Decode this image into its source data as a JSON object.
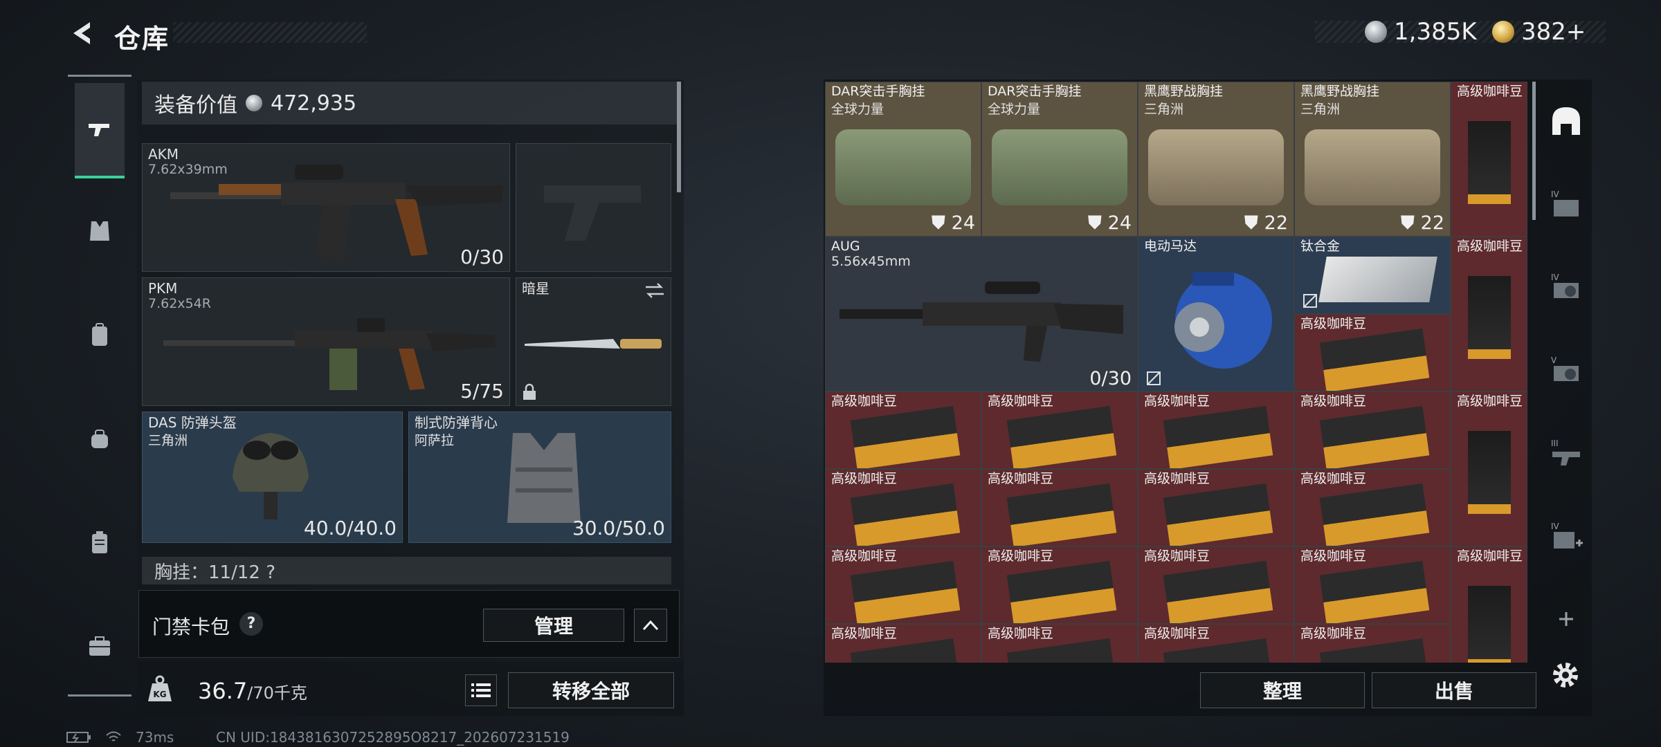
{
  "header": {
    "title": "仓库",
    "currency_silver": "1,385K",
    "currency_gold": "382+"
  },
  "rail": {
    "items": [
      "weapon-icon",
      "armor-vest-icon",
      "backpack-icon",
      "bag-icon",
      "clipboard-icon",
      "briefcase-icon"
    ]
  },
  "loadout": {
    "value_label": "装备价值",
    "value": "472,935",
    "primary": {
      "name": "AKM",
      "caliber": "7.62x39mm",
      "ammo": "0/30"
    },
    "secondary": {
      "name": "PKM",
      "caliber": "7.62x54R",
      "ammo": "5/75"
    },
    "melee": {
      "name": "暗星"
    },
    "helmet": {
      "name": "DAS 防弹头盔",
      "origin": "三角洲",
      "durability": "40.0/40.0"
    },
    "armor": {
      "name": "制式防弹背心",
      "origin": "阿萨拉",
      "durability": "30.0/50.0"
    },
    "chest_rig": "胸挂：11/12 ?",
    "keycard_label": "门禁卡包",
    "help_icon": "?",
    "manage_label": "管理",
    "collapse_glyph": "^",
    "weight_value": "36.7",
    "weight_max": "/70千克",
    "transfer_label": "转移全部"
  },
  "stash": {
    "row1": [
      {
        "name": "DAR突击手胸挂",
        "sub": "全球力量",
        "count": "24"
      },
      {
        "name": "DAR突击手胸挂",
        "sub": "全球力量",
        "count": "24"
      },
      {
        "name": "黑鹰野战胸挂",
        "sub": "三角洲",
        "count": "22"
      },
      {
        "name": "黑鹰野战胸挂",
        "sub": "三角洲",
        "count": "22"
      }
    ],
    "coffee_name": "高级咖啡豆",
    "aug": {
      "name": "AUG",
      "caliber": "5.56x45mm",
      "ammo": "0/30"
    },
    "motor": {
      "name": "电动马达"
    },
    "titanium": {
      "name": "钛合金"
    },
    "sort_label": "整理",
    "sell_label": "出售"
  },
  "side_tools": [
    "helmet-tab-icon",
    "tier-iv-bag-icon",
    "tier-iv-gear-icon",
    "tier-v-gear-icon",
    "tier-iii-gun-icon",
    "tier-iv-medkit-icon",
    "add-icon"
  ],
  "status": {
    "ping": "73ms",
    "uid": "CN UID:1843816307252895O8217_202607231519"
  },
  "colors": {
    "accent": "#39d29a",
    "coffee_cell": "#5e2a2d",
    "equipment_cell": "#5d5341",
    "armor_slot": "#2a3b4c"
  }
}
